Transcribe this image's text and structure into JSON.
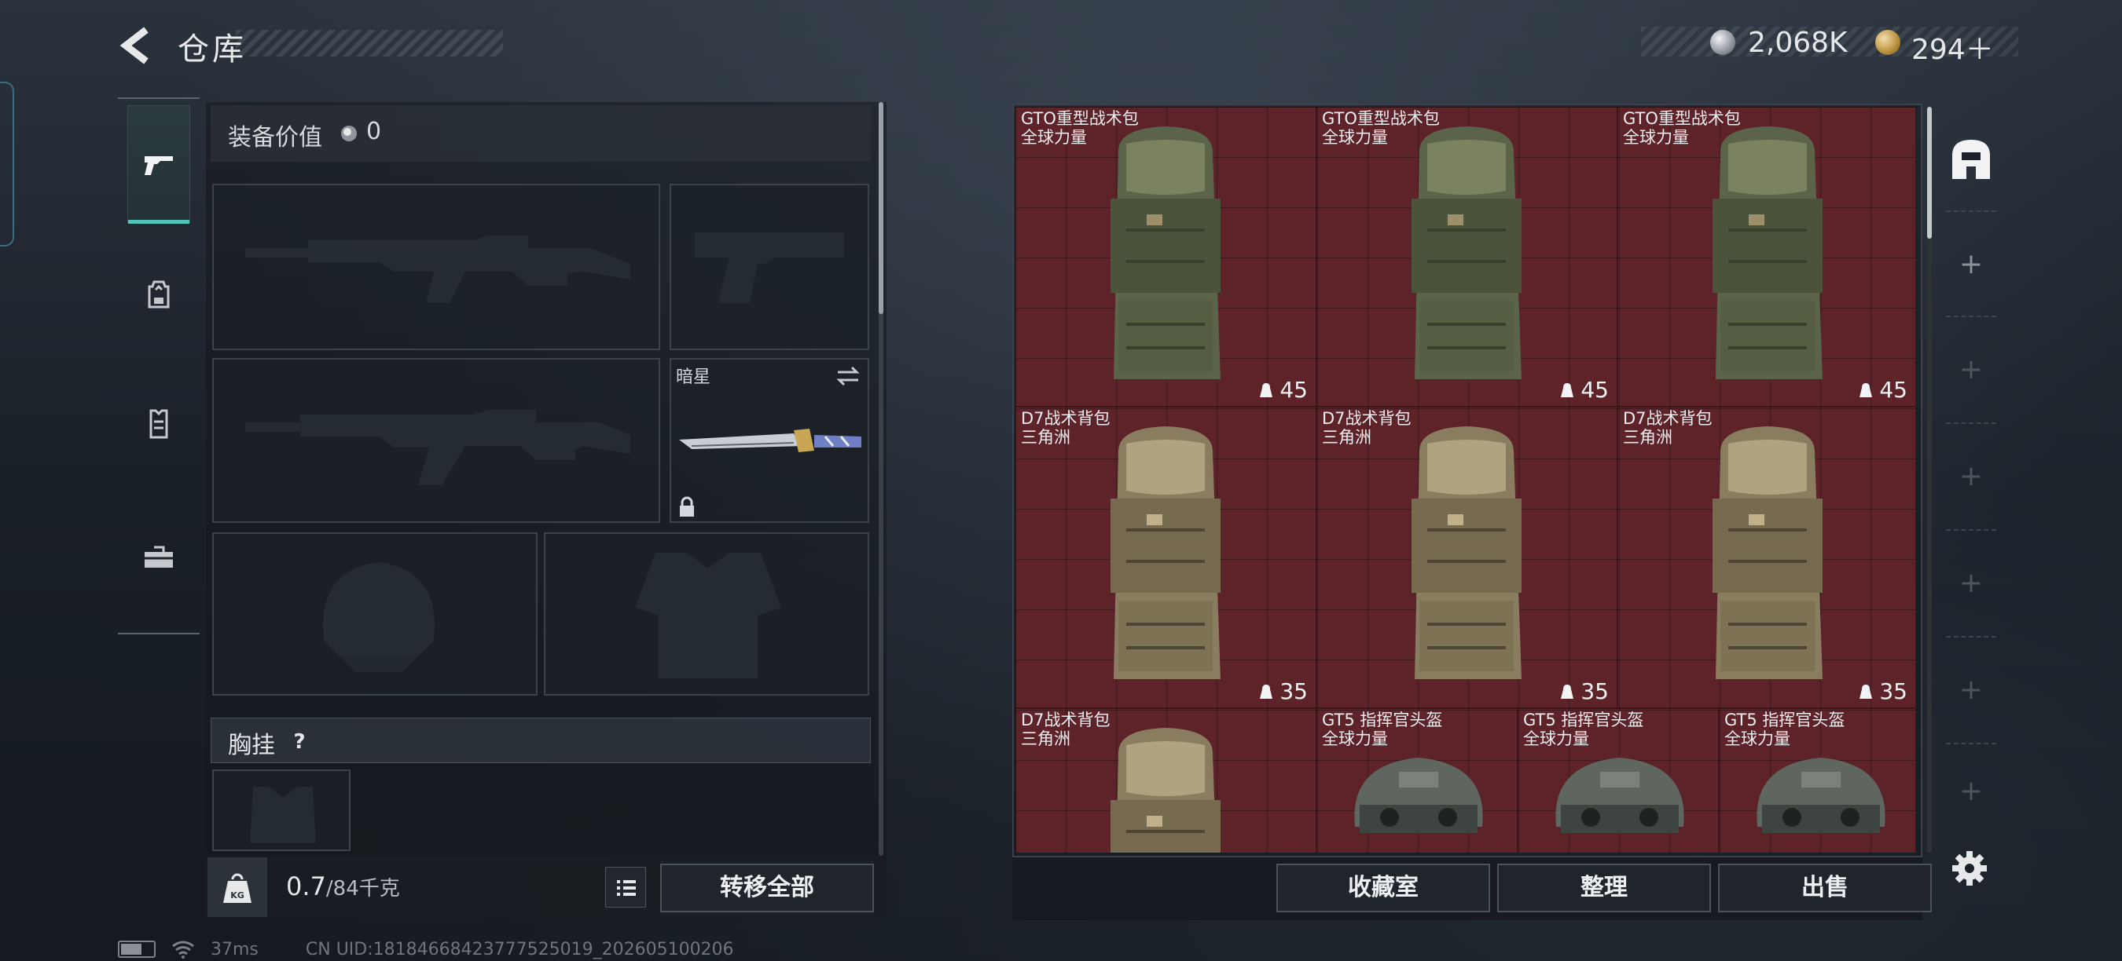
{
  "header": {
    "title": "仓库"
  },
  "currency": {
    "silver": "2,068K",
    "gold": "294＋"
  },
  "tabs": [
    {
      "name": "weapons-tab",
      "icon": "pistol-icon",
      "active": true
    },
    {
      "name": "backpack-tab",
      "icon": "backpack-icon",
      "active": false
    },
    {
      "name": "vest-tab",
      "icon": "vest-icon",
      "active": false
    },
    {
      "name": "toolbox-tab",
      "icon": "toolbox-icon",
      "active": false
    }
  ],
  "equipment": {
    "value_label": "装备价值",
    "value": "0",
    "melee_label": "暗星",
    "chest_label": "胸挂",
    "chest_help": "?"
  },
  "weight": {
    "current": "0.7",
    "max": "/84千克"
  },
  "buttons": {
    "transfer_all": "转移全部",
    "collection": "收藏室",
    "sort": "整理",
    "sell": "出售"
  },
  "items": [
    {
      "name": "GTO重型战术包",
      "sub": "全球力量",
      "capacity": "45",
      "kind": "backpack-green"
    },
    {
      "name": "GTO重型战术包",
      "sub": "全球力量",
      "capacity": "45",
      "kind": "backpack-green"
    },
    {
      "name": "GTO重型战术包",
      "sub": "全球力量",
      "capacity": "45",
      "kind": "backpack-green"
    },
    {
      "name": "D7战术背包",
      "sub": "三角洲",
      "capacity": "35",
      "kind": "backpack-tan"
    },
    {
      "name": "D7战术背包",
      "sub": "三角洲",
      "capacity": "35",
      "kind": "backpack-tan"
    },
    {
      "name": "D7战术背包",
      "sub": "三角洲",
      "capacity": "35",
      "kind": "backpack-tan"
    },
    {
      "name": "D7战术背包",
      "sub": "三角洲",
      "capacity": "",
      "kind": "backpack-tan"
    },
    {
      "name": "GT5 指挥官头盔",
      "sub": "全球力量",
      "capacity": "",
      "kind": "helmet"
    },
    {
      "name": "GT5 指挥官头盔",
      "sub": "全球力量",
      "capacity": "",
      "kind": "helmet"
    },
    {
      "name": "GT5 指挥官头盔",
      "sub": "全球力量",
      "capacity": "",
      "kind": "helmet"
    }
  ],
  "side": {
    "add_symbol": "+"
  },
  "status": {
    "ping": "37ms",
    "uid": "CN UID:18184668423777525019_202605100206"
  },
  "colors": {
    "accent": "#4fc3b8",
    "storage_bg": "#5e2329"
  }
}
